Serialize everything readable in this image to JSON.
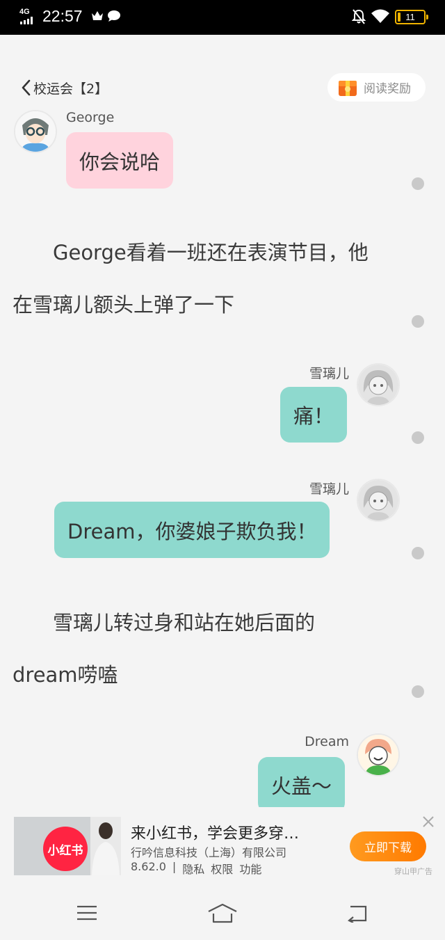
{
  "status_bar": {
    "network": "4G",
    "time": "22:57",
    "battery": "11",
    "battery_level": 0.11
  },
  "header": {
    "back_label": "校运会【2】",
    "reward_label": "阅读奖励"
  },
  "messages": [
    {
      "type": "bubble",
      "side": "left",
      "sender": "George",
      "text": "你会说哈",
      "color": "#ffd3dd"
    },
    {
      "type": "narration",
      "lines": [
        "　　George看着一班还在表演节目，他",
        "在雪璃儿额头上弹了一下"
      ]
    },
    {
      "type": "bubble",
      "side": "right",
      "sender": "雪璃儿",
      "text": "痛！",
      "color": "#8ed9ce"
    },
    {
      "type": "bubble",
      "side": "right",
      "sender": "雪璃儿",
      "text": "Dream，你婆娘子欺负我！",
      "color": "#8ed9ce"
    },
    {
      "type": "narration",
      "lines": [
        "　　雪璃儿转过身和站在她后面的",
        "dream唠嗑"
      ]
    },
    {
      "type": "bubble",
      "side": "right",
      "sender": "Dream",
      "text": "火盖～",
      "color": "#8ed9ce"
    }
  ],
  "ad": {
    "logo_text": "小红书",
    "title": "来小红书，学会更多穿…",
    "company": "行吟信息科技（上海）有限公司",
    "version": "8.62.0",
    "links": [
      "隐私",
      "权限",
      "功能"
    ],
    "download_label": "立即下载",
    "source": "穿山甲广告"
  },
  "colors": {
    "pink_bubble": "#ffd3dd",
    "teal_bubble": "#8ed9ce",
    "background": "#f4f4f4",
    "download_button": "#ff8a10"
  }
}
